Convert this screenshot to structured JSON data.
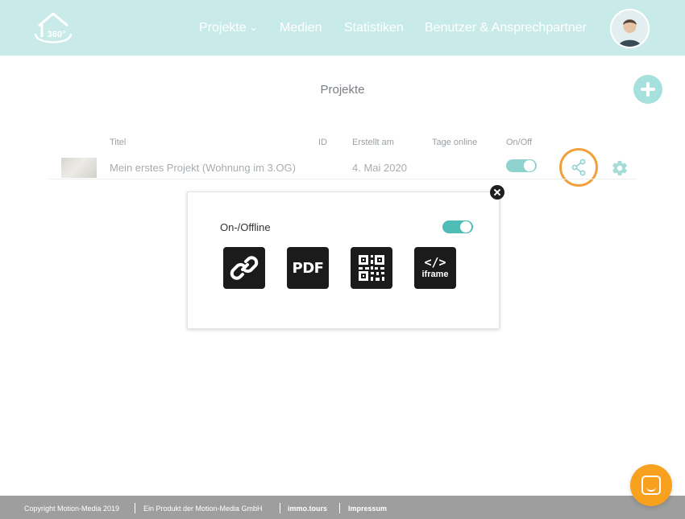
{
  "header": {
    "logo_text": "360°",
    "nav": [
      {
        "label": "Projekte",
        "has_dropdown": true
      },
      {
        "label": "Medien"
      },
      {
        "label": "Statistiken"
      },
      {
        "label": "Benutzer & Ansprechpartner"
      }
    ]
  },
  "page": {
    "title": "Projekte"
  },
  "table": {
    "columns": {
      "title": "Titel",
      "id": "ID",
      "created": "Erstellt am",
      "days_online": "Tage online",
      "onoff": "On/Off"
    },
    "rows": [
      {
        "title": "Mein erstes Projekt (Wohnung im 3.OG)",
        "id": "",
        "created": "4. Mai 2020",
        "days_online": "",
        "online": true
      }
    ]
  },
  "popup": {
    "label": "On-/Offline",
    "online": true,
    "tiles": {
      "pdf": "PDF",
      "iframe_code": "</>",
      "iframe_label": "iframe"
    }
  },
  "footer": {
    "copyright": "Copyright Motion-Media 2019",
    "product": "Ein Produkt der Motion-Media GmbH",
    "link1": "immo.tours",
    "link2": "Impressum"
  },
  "colors": {
    "header_bg": "#c8ebe9",
    "accent": "#4fbcb5",
    "highlight_ring": "#f2a03a",
    "chat": "#f7a11f",
    "footer_bg": "#9e9e9e"
  }
}
